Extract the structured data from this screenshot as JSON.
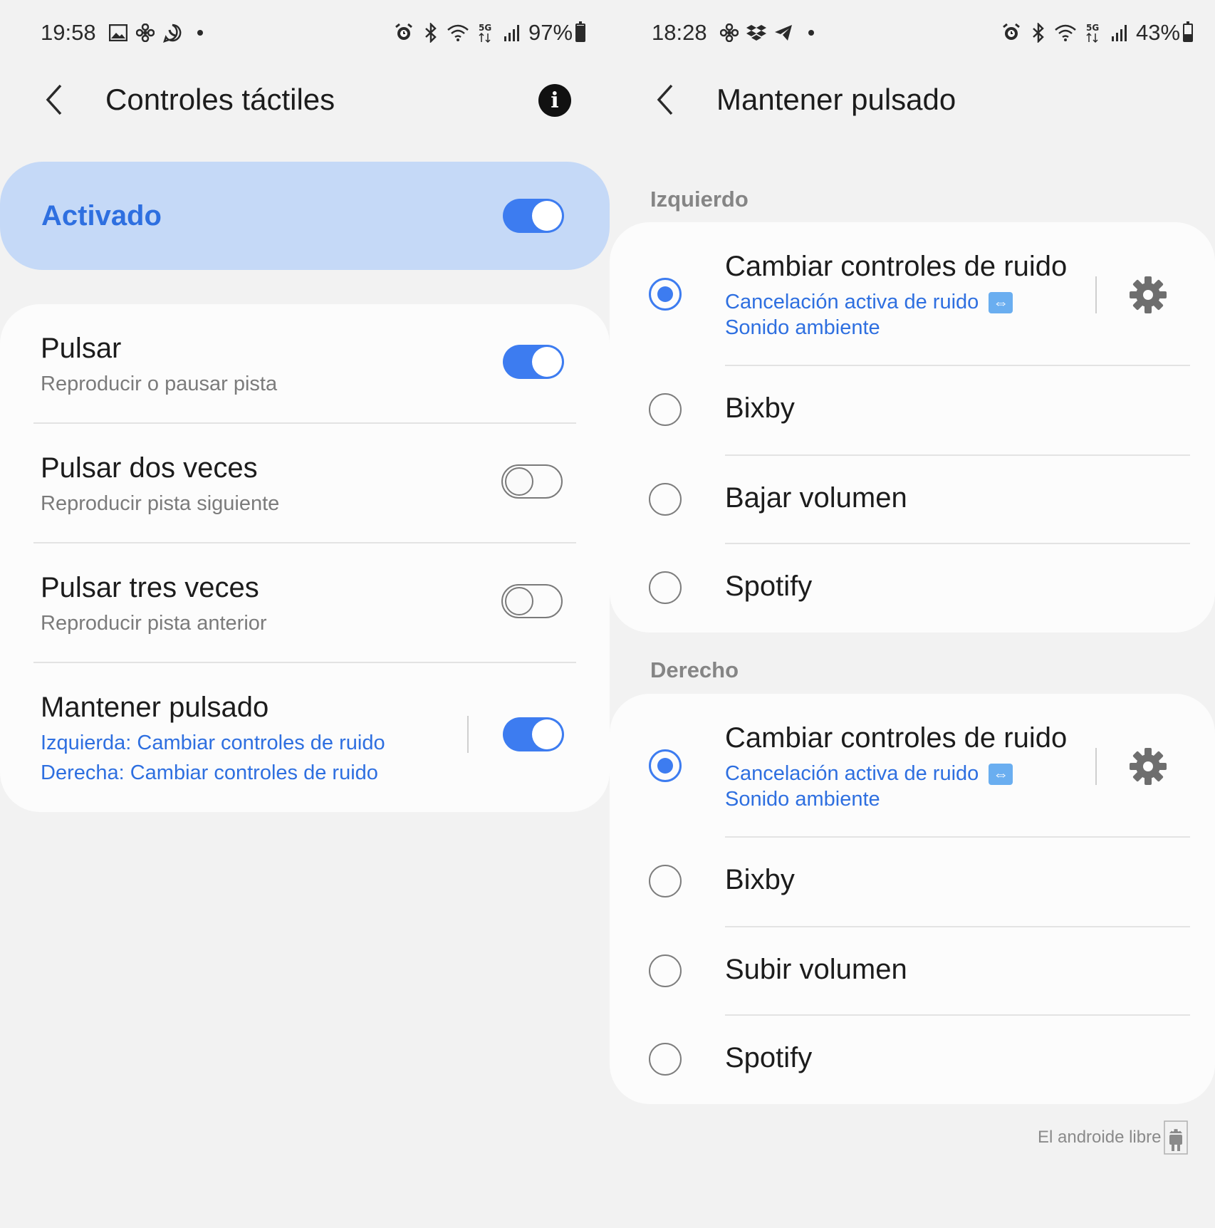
{
  "left": {
    "status": {
      "time": "19:58",
      "battery": "97%",
      "battery_level": 0.97
    },
    "title": "Controles táctiles",
    "master": {
      "label": "Activado",
      "on": true
    },
    "items": [
      {
        "title": "Pulsar",
        "subtitle": "Reproducir o pausar pista",
        "on": true
      },
      {
        "title": "Pulsar dos veces",
        "subtitle": "Reproducir pista siguiente",
        "on": false
      },
      {
        "title": "Pulsar tres veces",
        "subtitle": "Reproducir pista anterior",
        "on": false
      },
      {
        "title": "Mantener pulsado",
        "line1": "Izquierda: Cambiar controles de ruido",
        "line2": "Derecha: Cambiar controles de ruido",
        "on": true
      }
    ]
  },
  "right": {
    "status": {
      "time": "18:28",
      "battery": "43%",
      "battery_level": 0.43
    },
    "title": "Mantener pulsado",
    "sections": [
      {
        "label": "Izquierdo",
        "options": [
          {
            "title": "Cambiar controles de ruido",
            "sub1": "Cancelación activa de ruido",
            "sub2": "Sonido ambiente",
            "selected": true
          },
          {
            "title": "Bixby",
            "selected": false
          },
          {
            "title": "Bajar volumen",
            "selected": false
          },
          {
            "title": "Spotify",
            "selected": false
          }
        ]
      },
      {
        "label": "Derecho",
        "options": [
          {
            "title": "Cambiar controles de ruido",
            "sub1": "Cancelación activa de ruido",
            "sub2": "Sonido ambiente",
            "selected": true
          },
          {
            "title": "Bixby",
            "selected": false
          },
          {
            "title": "Subir volumen",
            "selected": false
          },
          {
            "title": "Spotify",
            "selected": false
          }
        ]
      }
    ]
  },
  "watermark": "El androide libre",
  "colors": {
    "accent": "#3d7cf0",
    "master_bg": "#c5d9f7",
    "link": "#2e6fe0",
    "background": "#f2f2f2"
  }
}
